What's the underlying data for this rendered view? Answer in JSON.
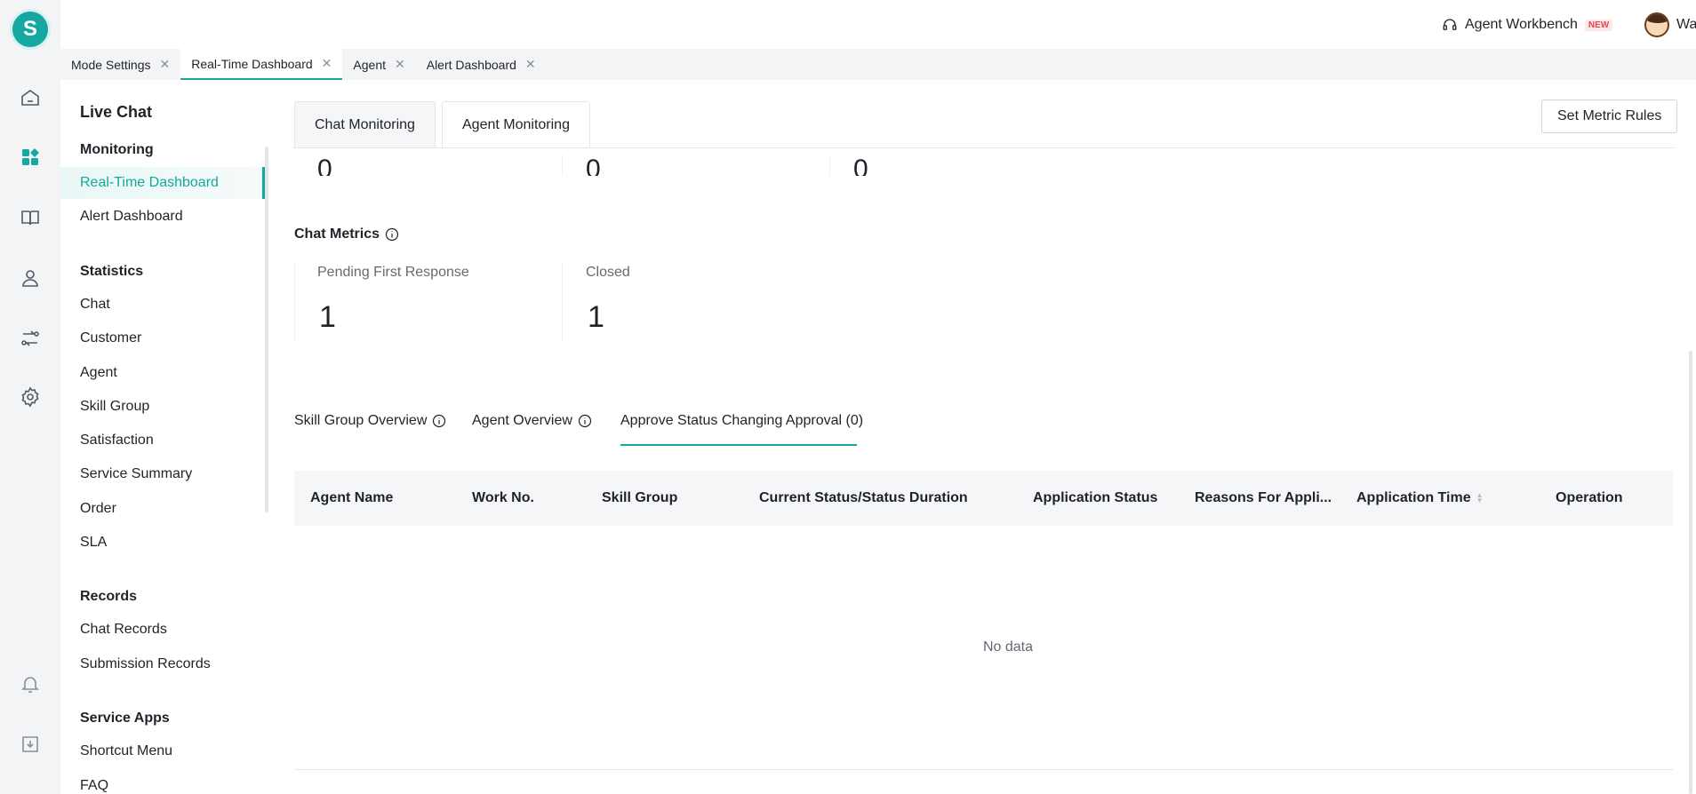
{
  "rail": {
    "logo_letter": "S",
    "icons": [
      "home-icon",
      "dashboard-icon",
      "book-icon",
      "agent-icon",
      "routing-icon",
      "settings-icon",
      "bell-icon",
      "download-icon"
    ]
  },
  "header": {
    "workbench_label": "Agent Workbench",
    "new_badge": "NEW",
    "user_name": "Wang"
  },
  "tabs": [
    {
      "label": "Mode Settings"
    },
    {
      "label": "Real-Time Dashboard",
      "active": true
    },
    {
      "label": "Agent"
    },
    {
      "label": "Alert Dashboard"
    }
  ],
  "sidebar": {
    "title": "Live Chat",
    "groups": {
      "monitoring": "Monitoring",
      "statistics": "Statistics",
      "records": "Records",
      "service_apps": "Service Apps"
    },
    "monitoring_items": [
      "Real-Time Dashboard",
      "Alert Dashboard"
    ],
    "statistics_items": [
      "Chat",
      "Customer",
      "Agent",
      "Skill Group",
      "Satisfaction",
      "Service Summary",
      "Order",
      "SLA"
    ],
    "records_items": [
      "Chat Records",
      "Submission Records"
    ],
    "service_apps_items": [
      "Shortcut Menu",
      "FAQ"
    ]
  },
  "main": {
    "tabs": [
      "Chat Monitoring",
      "Agent Monitoring"
    ],
    "active_tab": "Agent Monitoring",
    "set_metric_rules": "Set Metric Rules",
    "top_values": [
      "0",
      "0",
      "0"
    ],
    "chat_metrics_title": "Chat Metrics",
    "chat_metrics": [
      {
        "label": "Pending First Response",
        "value": "1"
      },
      {
        "label": "Closed",
        "value": "1"
      }
    ],
    "lower_tabs": [
      "Skill Group Overview",
      "Agent Overview",
      "Approve Status Changing Approval (0)"
    ],
    "table": {
      "columns": [
        "Agent Name",
        "Work No.",
        "Skill Group",
        "Current Status/Status Duration",
        "Application Status",
        "Reasons For Appli...",
        "Application Time",
        "Operation"
      ],
      "empty_text": "No data"
    }
  },
  "colors": {
    "accent": "#14a8a0",
    "new_badge": "#e5484d"
  }
}
